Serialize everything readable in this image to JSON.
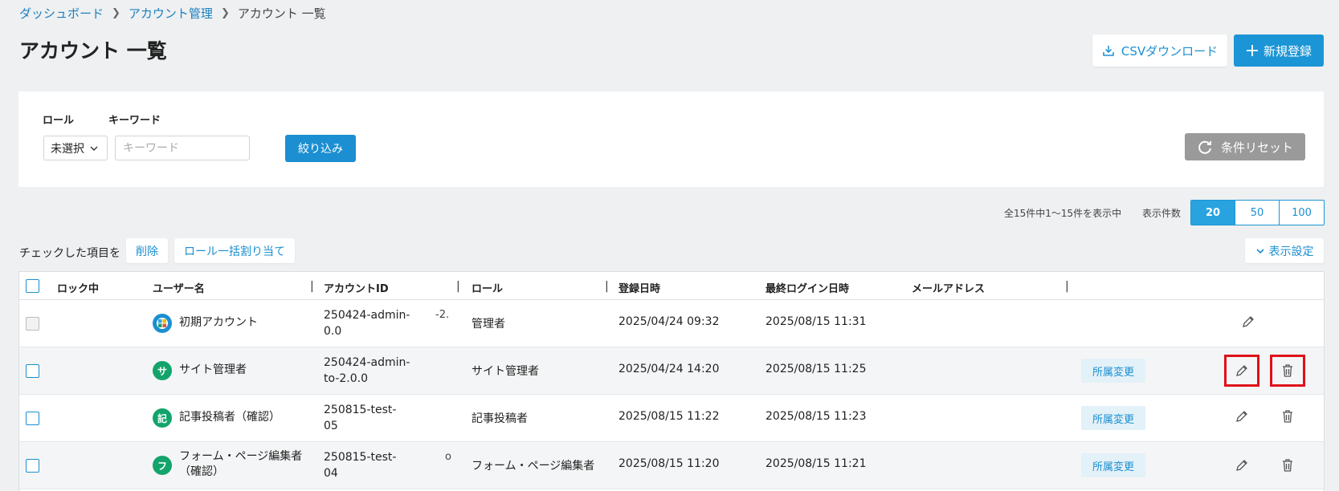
{
  "breadcrumb": {
    "items": [
      "ダッシュボード",
      "アカウント管理"
    ],
    "current": "アカウント 一覧"
  },
  "page_title": "アカウント 一覧",
  "toolbar": {
    "csv_label": "CSVダウンロード",
    "new_label": "新規登録"
  },
  "filter": {
    "role_label": "ロール",
    "role_selected": "未選択",
    "keyword_label": "キーワード",
    "keyword_placeholder": "キーワード",
    "filter_button": "絞り込み",
    "reset_button": "条件リセット"
  },
  "pagination": {
    "count_text": "全15件中1〜15件を表示中",
    "per_page_label": "表示件数",
    "options": [
      "20",
      "50",
      "100"
    ],
    "selected": "20"
  },
  "bulk": {
    "label": "チェックした項目を",
    "delete_button": "削除",
    "role_assign_button": "ロール一括割り当て",
    "display_settings": "表示設定"
  },
  "table": {
    "headers": {
      "locked": "ロック中",
      "username": "ユーザー名",
      "account_id": "アカウントID",
      "role": "ロール",
      "registered": "登録日時",
      "last_login": "最終ログイン日時",
      "email": "メールアドレス"
    },
    "affil_label": "所属変更",
    "rows": [
      {
        "avatar": "",
        "name": "初期アカウント",
        "account_id_1": "250424-admin-",
        "account_id_2": "0.0",
        "extra": "-2.",
        "role": "管理者",
        "registered": "2025/04/24 09:32",
        "last_login": "2025/08/15 11:31"
      },
      {
        "avatar": "サ",
        "name": "サイト管理者",
        "account_id_1": "250424-admin-",
        "account_id_2": "to-2.0.0",
        "extra": "",
        "role": "サイト管理者",
        "registered": "2025/04/24 14:20",
        "last_login": "2025/08/15 11:25"
      },
      {
        "avatar": "記",
        "name": "記事投稿者（確認）",
        "account_id_1": "250815-test-",
        "account_id_2": "05",
        "extra": "",
        "role": "記事投稿者",
        "registered": "2025/08/15 11:22",
        "last_login": "2025/08/15 11:23"
      },
      {
        "avatar": "フ",
        "name": "フォーム・ページ編集者",
        "name_2": "（確認）",
        "account_id_1": "250815-test-",
        "account_id_2": "04",
        "extra": "o",
        "role": "フォーム・ページ編集者",
        "registered": "2025/08/15 11:20",
        "last_login": "2025/08/15 11:21"
      }
    ]
  },
  "colors": {
    "primary": "#1b95d6",
    "highlight": "#e0101a",
    "reset": "#9a9a9a"
  }
}
